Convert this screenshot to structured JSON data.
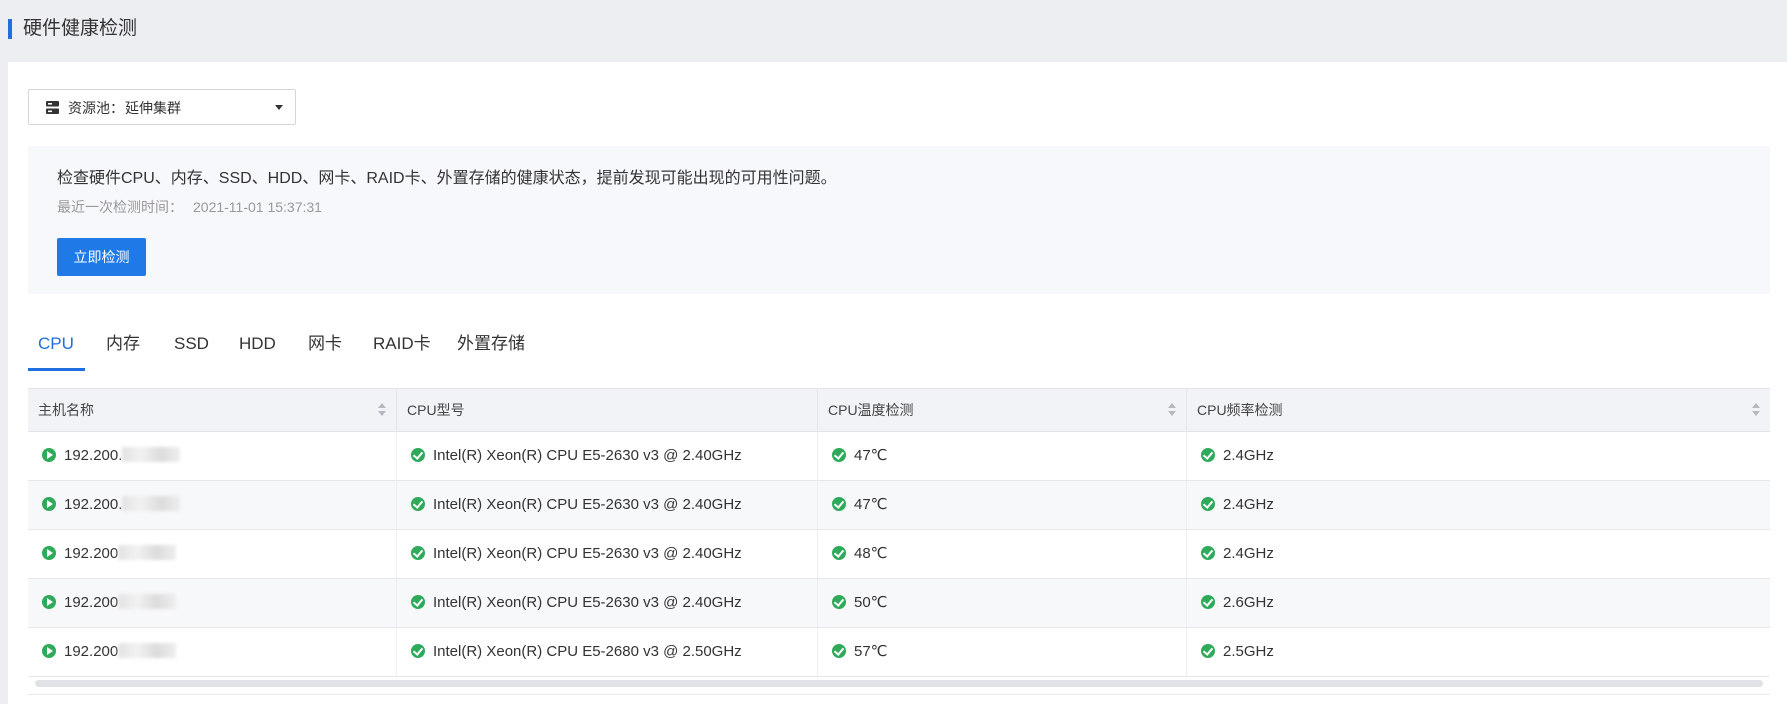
{
  "page": {
    "title": "硬件健康检测"
  },
  "pool": {
    "label": "资源池：",
    "value": "延伸集群"
  },
  "info": {
    "description": "检查硬件CPU、内存、SSD、HDD、网卡、RAID卡、外置存储的健康状态，提前发现可能出现的可用性问题。",
    "last_check_label": "最近一次检测时间：",
    "last_check_value": "2021-11-01 15:37:31",
    "run_button": "立即检测"
  },
  "tabs": [
    "CPU",
    "内存",
    "SSD",
    "HDD",
    "网卡",
    "RAID卡",
    "外置存储"
  ],
  "active_tab": "CPU",
  "table": {
    "columns": [
      "主机名称",
      "CPU型号",
      "CPU温度检测",
      "CPU频率检测"
    ],
    "rows": [
      {
        "host": "192.200.",
        "model": "Intel(R) Xeon(R) CPU E5-2630 v3 @ 2.40GHz",
        "temp": "47℃",
        "freq": "2.4GHz"
      },
      {
        "host": "192.200.",
        "model": "Intel(R) Xeon(R) CPU E5-2630 v3 @ 2.40GHz",
        "temp": "47℃",
        "freq": "2.4GHz"
      },
      {
        "host": "192.200",
        "model": "Intel(R) Xeon(R) CPU E5-2630 v3 @ 2.40GHz",
        "temp": "48℃",
        "freq": "2.4GHz"
      },
      {
        "host": "192.200",
        "model": "Intel(R) Xeon(R) CPU E5-2630 v3 @ 2.40GHz",
        "temp": "50℃",
        "freq": "2.6GHz"
      },
      {
        "host": "192.200",
        "model": "Intel(R) Xeon(R) CPU E5-2680 v3 @ 2.50GHz",
        "temp": "57℃",
        "freq": "2.5GHz"
      }
    ]
  },
  "colors": {
    "accent": "#1f6fe0",
    "button": "#1f7ae8",
    "ok": "#2faa5b"
  },
  "icons": {
    "pool": "server-icon",
    "status": "check-circle-icon",
    "host": "play-circle-icon"
  }
}
